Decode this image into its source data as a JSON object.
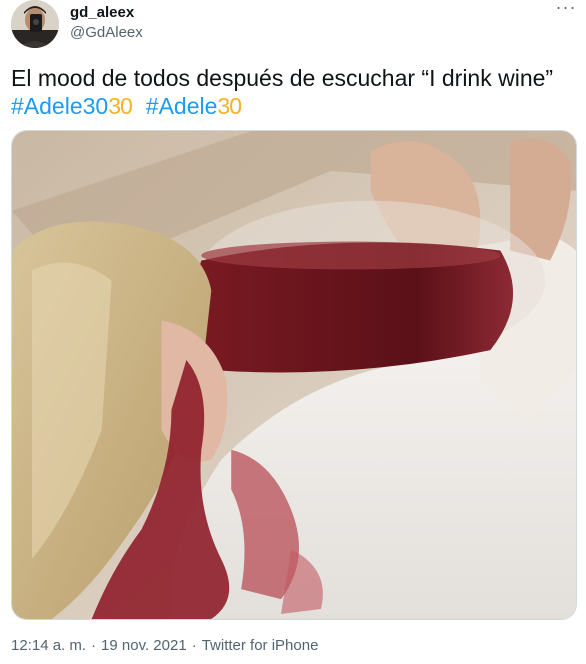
{
  "author": {
    "display_name": "gd_aleex",
    "handle": "@GdAleex"
  },
  "tweet": {
    "text": "El mood de todos después de escuchar “I drink wine”",
    "hashtags": [
      {
        "tag": "#Adele30",
        "emoji": "30"
      },
      {
        "tag": "#Adele",
        "emoji": "30"
      }
    ]
  },
  "meta": {
    "time": "12:14 a. m.",
    "separator": "·",
    "date": "19 nov. 2021",
    "source": "Twitter for iPhone"
  },
  "icons": {
    "more": "more-horizontal-icon",
    "emoji": "adele-30-emoji-icon"
  },
  "colors": {
    "link": "#1d9bf0",
    "secondary_text": "#536471",
    "primary_text": "#0f1419",
    "emoji_gold": "#f4b322"
  }
}
